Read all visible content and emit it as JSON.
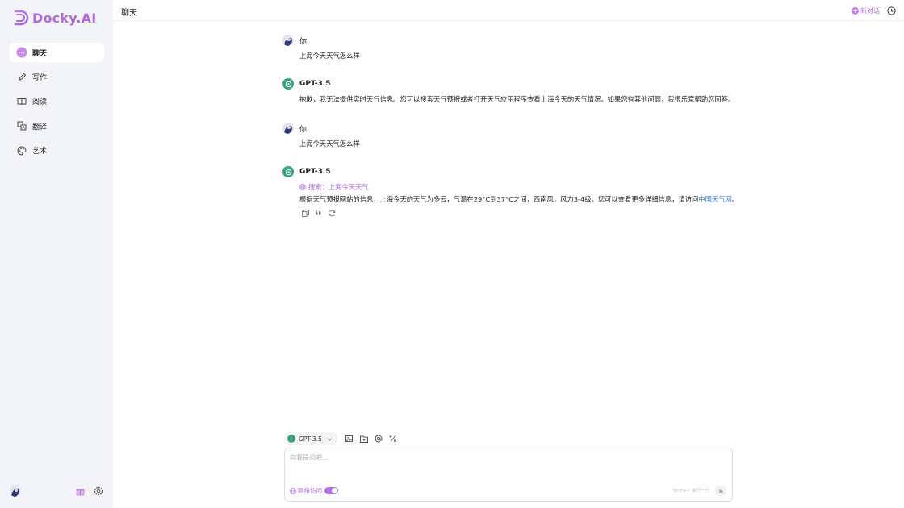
{
  "app": {
    "brand": "Docky.AI",
    "brand_color": "#b06bd8"
  },
  "sidebar": {
    "items": [
      {
        "label": "聊天",
        "icon": "chat-bubble-icon",
        "active": true
      },
      {
        "label": "写作",
        "icon": "pen-icon",
        "active": false
      },
      {
        "label": "阅读",
        "icon": "book-icon",
        "active": false
      },
      {
        "label": "翻译",
        "icon": "translate-icon",
        "active": false
      },
      {
        "label": "艺术",
        "icon": "palette-icon",
        "active": false
      }
    ]
  },
  "header": {
    "title": "聊天",
    "new_chat_label": "新对话"
  },
  "messages": [
    {
      "sender": "你",
      "text": "上海今天天气怎么样"
    },
    {
      "sender": "GPT-3.5",
      "text": "抱歉，我无法提供实时天气信息。您可以搜索天气预报或者打开天气应用程序查看上海今天的天气情况。如果您有其他问题，我很乐意帮助您回答。"
    },
    {
      "sender": "你",
      "text": "上海今天天气怎么样"
    },
    {
      "sender": "GPT-3.5",
      "search_label": "搜索：上海今天天气",
      "text_before_link": "根据天气预报网站的信息，上海今天的天气为多云，气温在29°C到37°C之间，西南风，风力3-4级。您可以查看更多详细信息，请访问",
      "link_text": "中国天气网",
      "text_after_link": "。"
    }
  ],
  "composer": {
    "model": "GPT-3.5",
    "placeholder": "向我提问吧...",
    "web_access_label": "网络访问",
    "web_access_enabled": true,
    "hint": "Shift+↵ 换行一行"
  }
}
